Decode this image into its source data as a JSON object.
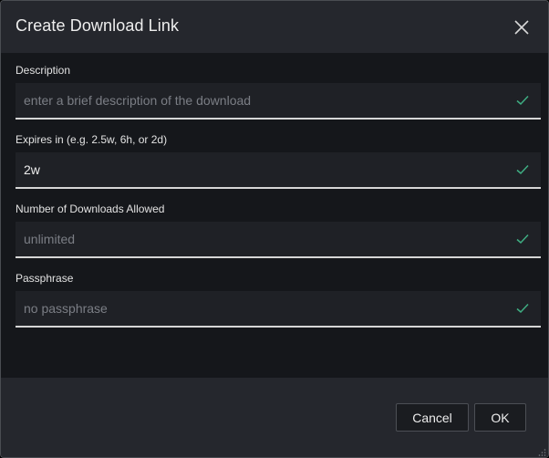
{
  "dialog": {
    "title": "Create Download Link"
  },
  "fields": [
    {
      "label": "Description",
      "value": "",
      "placeholder": "enter a brief description of the download"
    },
    {
      "label": "Expires in (e.g. 2.5w, 6h, or 2d)",
      "value": "2w",
      "placeholder": ""
    },
    {
      "label": "Number of Downloads Allowed",
      "value": "",
      "placeholder": "unlimited"
    },
    {
      "label": "Passphrase",
      "value": "",
      "placeholder": "no passphrase"
    }
  ],
  "footer": {
    "cancel_label": "Cancel",
    "ok_label": "OK"
  },
  "icons": {
    "close": "close-icon",
    "valid": "checkmark-icon",
    "resize": "resize-grip-icon"
  },
  "colors": {
    "header_bg": "#25272d",
    "body_bg": "#15171b",
    "check": "#3fae83"
  }
}
